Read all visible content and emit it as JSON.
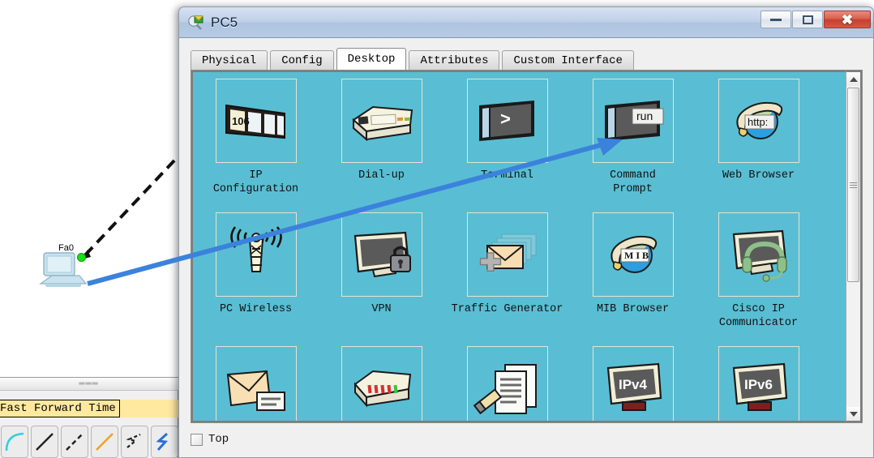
{
  "window": {
    "title": "PC5",
    "icon": "packet-tracer-icon",
    "controls": {
      "minimize": "minimize",
      "maximize": "maximize",
      "close": "close"
    }
  },
  "tabs": [
    {
      "label": "Physical",
      "active": false
    },
    {
      "label": "Config",
      "active": false
    },
    {
      "label": "Desktop",
      "active": true
    },
    {
      "label": "Attributes",
      "active": false
    },
    {
      "label": "Custom Interface",
      "active": false
    }
  ],
  "desktop": {
    "background_color": "#59bed3",
    "rows": [
      [
        {
          "label": "IP\nConfiguration",
          "icon": "ip-configuration-icon",
          "badge": "106"
        },
        {
          "label": "Dial-up",
          "icon": "dial-up-modem-icon",
          "badge": ""
        },
        {
          "label": "Terminal",
          "icon": "terminal-icon",
          "badge": ">"
        },
        {
          "label": "Command\nPrompt",
          "icon": "command-prompt-icon",
          "badge": "run"
        },
        {
          "label": "Web Browser",
          "icon": "web-browser-icon",
          "badge": "http:"
        }
      ],
      [
        {
          "label": "PC Wireless",
          "icon": "pc-wireless-antenna-icon",
          "badge": ""
        },
        {
          "label": "VPN",
          "icon": "vpn-lock-icon",
          "badge": ""
        },
        {
          "label": "Traffic Generator",
          "icon": "traffic-generator-icon",
          "badge": ""
        },
        {
          "label": "MIB Browser",
          "icon": "mib-browser-icon",
          "badge": "MIB"
        },
        {
          "label": "Cisco IP\nCommunicator",
          "icon": "cisco-ip-communicator-icon",
          "badge": ""
        }
      ],
      [
        {
          "label": "",
          "icon": "email-icon",
          "badge": ""
        },
        {
          "label": "",
          "icon": "pppoe-dialer-icon",
          "badge": ""
        },
        {
          "label": "",
          "icon": "text-editor-icon",
          "badge": ""
        },
        {
          "label": "",
          "icon": "ipv4-firewall-icon",
          "badge": "IPv4"
        },
        {
          "label": "",
          "icon": "ipv6-firewall-icon",
          "badge": "IPv6"
        }
      ]
    ]
  },
  "bottom": {
    "top_checkbox_label": "Top",
    "top_checkbox_checked": false
  },
  "workspace": {
    "device_label": "Fa0",
    "device_icon": "pc-workstation-icon",
    "link_status": "up",
    "link_color": "#13e313",
    "annotation_arrow_color": "#3b82dc"
  },
  "toolbar": {
    "tooltip": "Fast Forward Time",
    "buttons": [
      {
        "name": "connection-console",
        "icon": "curved-cyan-line-icon"
      },
      {
        "name": "connection-copper-straight",
        "icon": "solid-black-line-icon"
      },
      {
        "name": "connection-copper-crossover",
        "icon": "dashed-black-line-icon"
      },
      {
        "name": "connection-fiber",
        "icon": "orange-line-icon"
      },
      {
        "name": "connection-phone",
        "icon": "dotted-zigzag-icon"
      },
      {
        "name": "connection-coaxial",
        "icon": "blue-lightning-icon"
      }
    ]
  }
}
